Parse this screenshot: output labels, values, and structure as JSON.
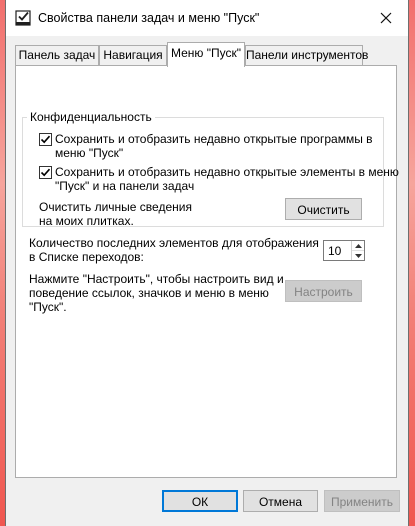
{
  "window": {
    "title": "Свойства панели задач и меню \"Пуск\"",
    "icon": "taskbar-properties-icon",
    "close_icon": "close-icon"
  },
  "tabs": [
    {
      "label": "Панель задач",
      "active": false
    },
    {
      "label": "Навигация",
      "active": false
    },
    {
      "label": "Меню \"Пуск\"",
      "active": true
    },
    {
      "label": "Панели инструментов",
      "active": false
    }
  ],
  "privacy": {
    "legend": "Конфиденциальность",
    "checkbox1": {
      "line1": "Сохранить и отобразить недавно открытые программы в",
      "line2": "меню \"Пуск\"",
      "checked": true
    },
    "checkbox2": {
      "line1": "Сохранить и отобразить недавно открытые элементы в меню",
      "line2": "\"Пуск\" и на панели задач",
      "checked": true
    },
    "clear_text_line1": "Очистить личные сведения",
    "clear_text_line2": "на моих плитках.",
    "clear_button": "Очистить"
  },
  "jumplist": {
    "label_line1": "Количество последних элементов для отображения",
    "label_line2": "в Списке переходов:",
    "value": "10"
  },
  "customize": {
    "text_line1": "Нажмите \"Настроить\", чтобы настроить вид и",
    "text_line2": "поведение ссылок, значков и меню в меню",
    "text_line3": "\"Пуск\".",
    "button": "Настроить"
  },
  "footer": {
    "ok": "ОК",
    "cancel": "Отмена",
    "apply": "Применить"
  },
  "colors": {
    "accent": "#0078d7",
    "background": "#f0f0f0",
    "wallpaper": "#f26f6d"
  }
}
